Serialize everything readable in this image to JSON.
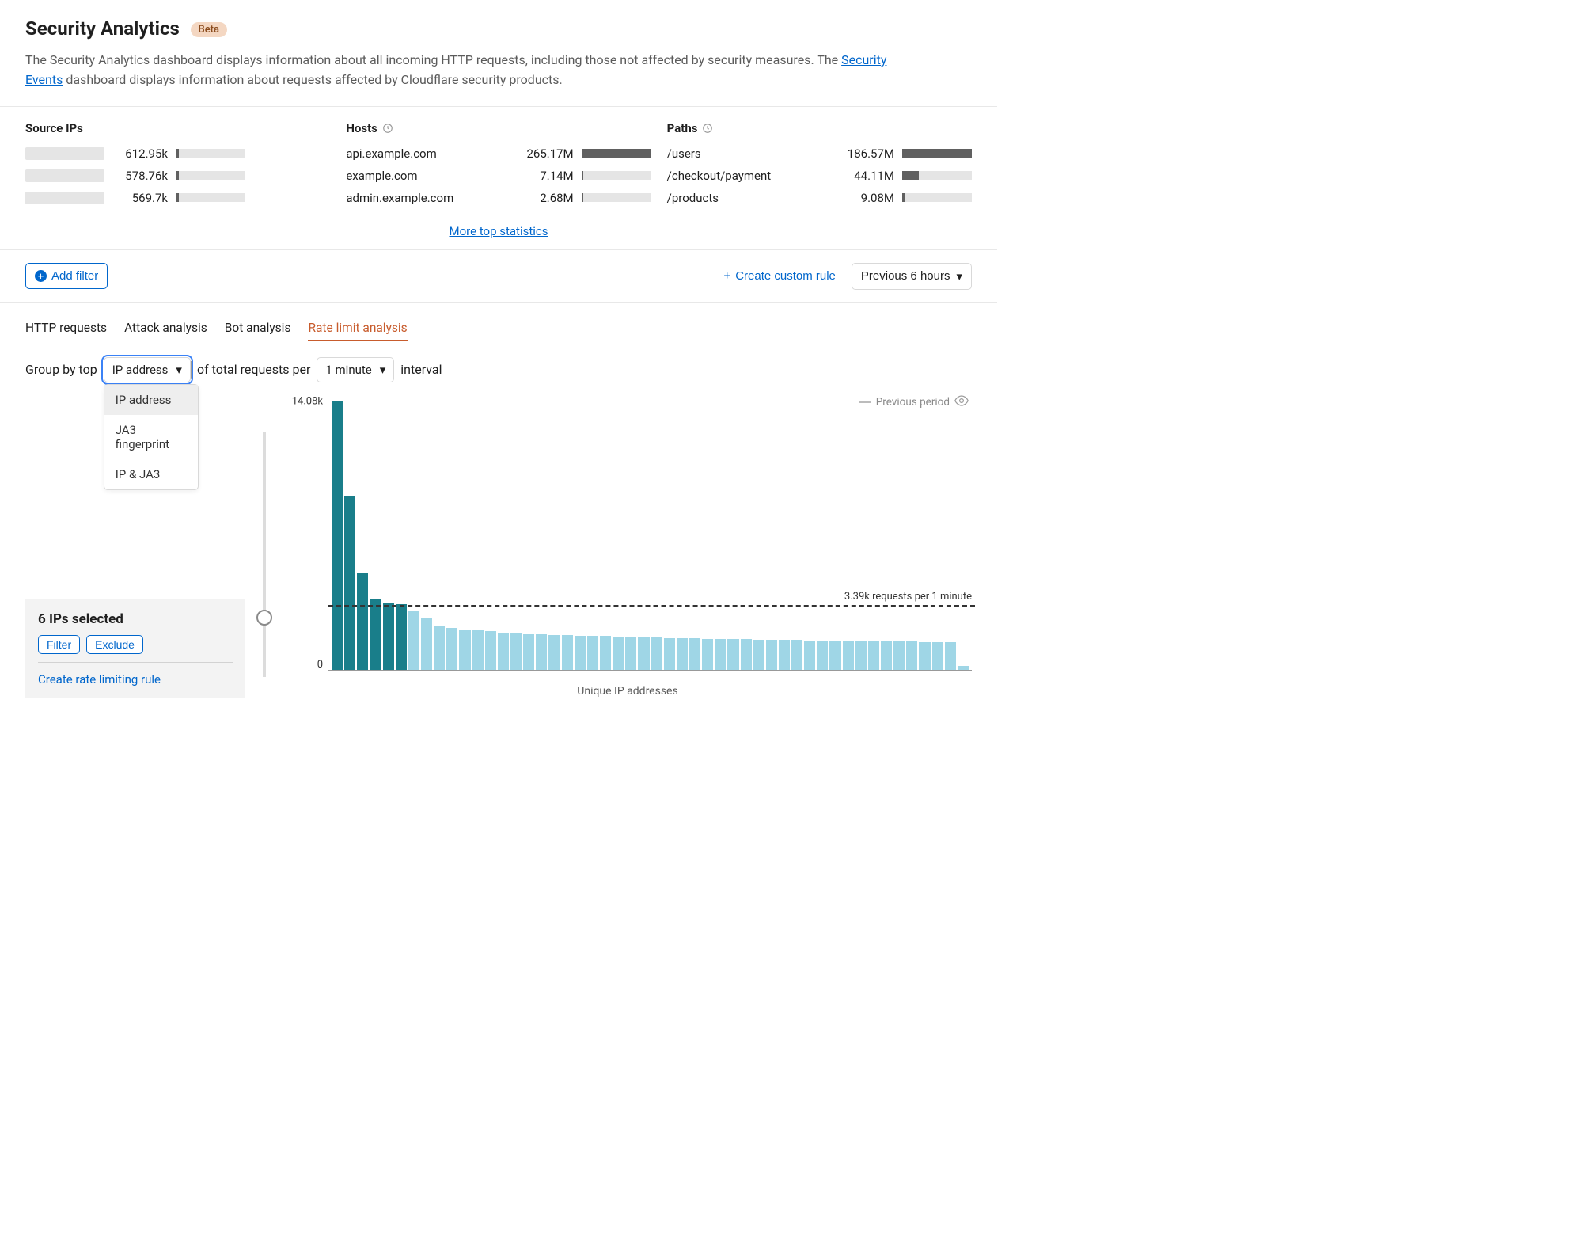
{
  "header": {
    "title": "Security Analytics",
    "badge": "Beta",
    "intro_1": "The Security Analytics dashboard displays information about all incoming HTTP requests, including those not affected by security measures. The ",
    "intro_link": "Security Events",
    "intro_2": " dashboard displays information about requests affected by Cloudflare security products."
  },
  "top_stats": {
    "more_link": "More top statistics",
    "cols": [
      {
        "head": "Source IPs",
        "clock": false,
        "max": 612950,
        "rows": [
          {
            "label": "",
            "value": "612.95k",
            "n": 612950,
            "placeholder": true
          },
          {
            "label": "",
            "value": "578.76k",
            "n": 578760,
            "placeholder": true
          },
          {
            "label": "",
            "value": "569.7k",
            "n": 569700,
            "placeholder": true
          }
        ]
      },
      {
        "head": "Hosts",
        "clock": true,
        "max": 265170000,
        "rows": [
          {
            "label": "api.example.com",
            "value": "265.17M",
            "n": 265170000
          },
          {
            "label": "example.com",
            "value": "7.14M",
            "n": 7140000
          },
          {
            "label": "admin.example.com",
            "value": "2.68M",
            "n": 2680000
          }
        ]
      },
      {
        "head": "Paths",
        "clock": true,
        "max": 186570000,
        "rows": [
          {
            "label": "/users",
            "value": "186.57M",
            "n": 186570000
          },
          {
            "label": "/checkout/payment",
            "value": "44.11M",
            "n": 44110000
          },
          {
            "label": "/products",
            "value": "9.08M",
            "n": 9080000
          }
        ]
      }
    ]
  },
  "filter_bar": {
    "add_filter": "Add filter",
    "create_rule": "Create custom rule",
    "timerange": "Previous 6 hours"
  },
  "tabs": {
    "items": [
      "HTTP requests",
      "Attack analysis",
      "Bot analysis",
      "Rate limit analysis"
    ],
    "active": 3
  },
  "controls": {
    "label_1": "Group by top",
    "groupby_selected": "IP address",
    "groupby_options": [
      "IP address",
      "JA3 fingerprint",
      "IP & JA3"
    ],
    "label_2": "of total requests per",
    "interval_selected": "1 minute",
    "label_3": "interval"
  },
  "legend": {
    "previous_period": "Previous period"
  },
  "side_panel": {
    "title": "6 IPs selected",
    "filter_btn": "Filter",
    "exclude_btn": "Exclude",
    "rule_link": "Create rate limiting rule"
  },
  "chart_data": {
    "type": "bar",
    "title": "",
    "xlabel": "Unique IP addresses",
    "ylabel": "",
    "ylim": [
      0,
      14080
    ],
    "y_ticks": [
      0,
      14080
    ],
    "y_tick_labels": [
      "0",
      "14.08k"
    ],
    "threshold_value": 3390,
    "threshold_label": "3.39k requests per 1 minute",
    "selected_count": 6,
    "values": [
      14080,
      9100,
      5100,
      3700,
      3500,
      3450,
      3050,
      2700,
      2300,
      2200,
      2100,
      2050,
      2000,
      1950,
      1900,
      1870,
      1850,
      1830,
      1810,
      1790,
      1770,
      1750,
      1730,
      1710,
      1690,
      1670,
      1650,
      1640,
      1630,
      1620,
      1610,
      1600,
      1590,
      1580,
      1570,
      1560,
      1550,
      1540,
      1530,
      1520,
      1510,
      1500,
      1490,
      1480,
      1470,
      1460,
      1450,
      1440,
      1430,
      180
    ]
  }
}
